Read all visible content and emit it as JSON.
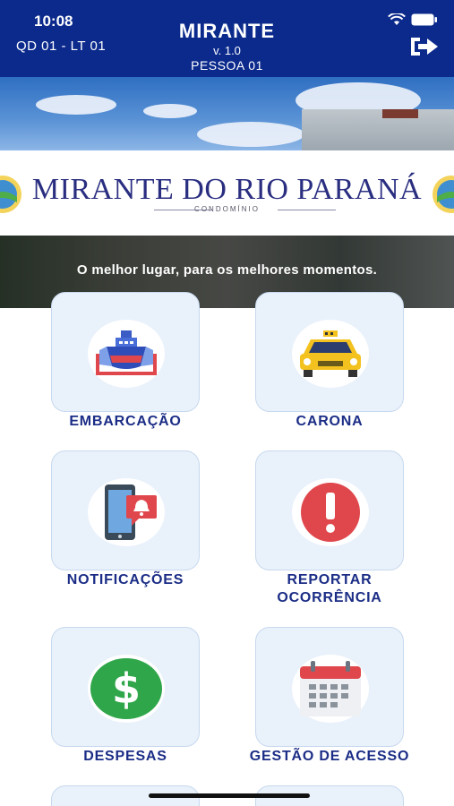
{
  "status_bar": {
    "time": "10:08"
  },
  "header": {
    "lot": "QD 01 - LT 01",
    "title": "MIRANTE",
    "version": "v. 1.0",
    "person": "PESSOA 01",
    "logout_icon": "logout-icon"
  },
  "banner": {
    "brand": "MIRANTE DO RIO PARANÁ",
    "brand_sub": "CONDOMÍNIO",
    "tagline": "O melhor lugar, para os melhores momentos."
  },
  "menu": [
    {
      "label": "EMBARCAÇÃO",
      "icon": "boat-icon"
    },
    {
      "label": "CARONA",
      "icon": "taxi-icon"
    },
    {
      "label": "NOTIFICAÇÕES",
      "icon": "phone-notification-icon"
    },
    {
      "label_line1": "REPORTAR",
      "label_line2": "OCORRÊNCIA",
      "icon": "alert-icon"
    },
    {
      "label": "DESPESAS",
      "icon": "dollar-icon"
    },
    {
      "label": "GESTÃO DE ACESSO",
      "icon": "calendar-icon"
    }
  ],
  "colors": {
    "header": "#0b2a8c",
    "label": "#1b2d86",
    "tile": "#e9f1fb"
  }
}
